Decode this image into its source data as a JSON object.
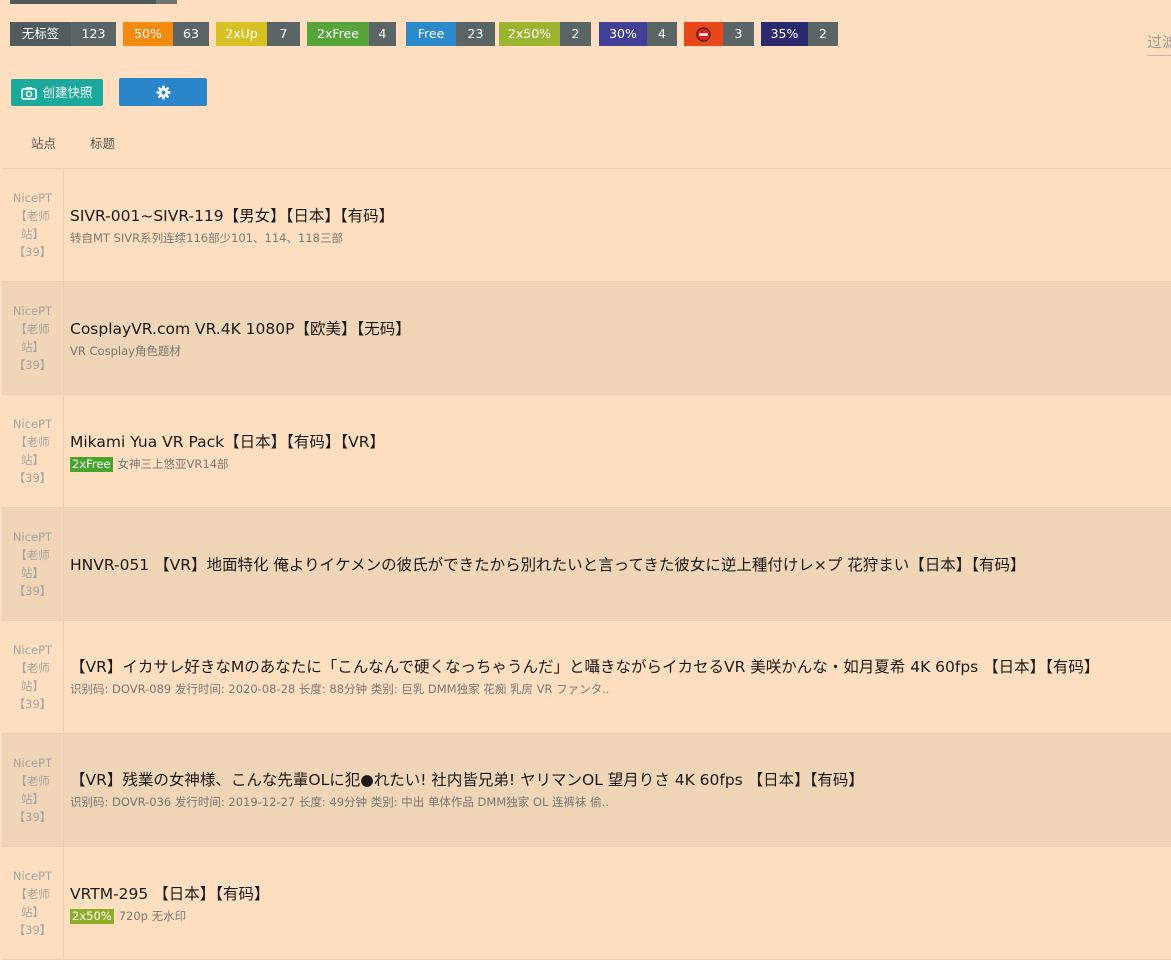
{
  "filters": [
    {
      "label": "无标签",
      "count": "123",
      "color": "#515c5c"
    },
    {
      "label": "50%",
      "count": "63",
      "color": "#f58a10"
    },
    {
      "label": "2xUp",
      "count": "7",
      "color": "#d8c125"
    },
    {
      "label": "2xFree",
      "count": "4",
      "color": "#55a53b"
    },
    {
      "label": "Free",
      "count": "23",
      "color": "#2a8acb"
    },
    {
      "label": "2x50%",
      "count": "2",
      "color": "#9bb531"
    },
    {
      "label": "30%",
      "count": "4",
      "color": "#414096"
    },
    {
      "label": "",
      "count": "3",
      "color": "#e9471a",
      "icon": "no-entry-icon"
    },
    {
      "label": "35%",
      "count": "2",
      "color": "#2c2a6e"
    }
  ],
  "filter_label": "过滤",
  "toolbar": {
    "snapshot_label": "创建快照",
    "settings_icon": "gear-icon"
  },
  "table": {
    "headers": [
      "站点",
      "标题"
    ]
  },
  "rows": [
    {
      "site": [
        "NicePT",
        "【老师",
        "站】",
        "【39】"
      ],
      "title": "SIVR-001~SIVR-119【男女】【日本】【有码】",
      "tag": "",
      "subtitle": "转自MT SIVR系列连续116部少101、114、118三部"
    },
    {
      "site": [
        "NicePT",
        "【老师",
        "站】",
        "【39】"
      ],
      "title": "CosplayVR.com VR.4K 1080P【欧美】【无码】",
      "tag": "",
      "subtitle": "VR Cosplay角色题材"
    },
    {
      "site": [
        "NicePT",
        "【老师",
        "站】",
        "【39】"
      ],
      "title": "Mikami Yua VR Pack【日本】【有码】【VR】",
      "tag": "2xFree",
      "subtitle": "女神三上悠亚VR14部"
    },
    {
      "site": [
        "NicePT",
        "【老师",
        "站】",
        "【39】"
      ],
      "title": "HNVR-051 【VR】地面特化 俺よりイケメンの彼氏ができたから別れたいと言ってきた彼女に逆上種付けレ×プ 花狩まい【日本】【有码】",
      "tag": "",
      "subtitle": ""
    },
    {
      "site": [
        "NicePT",
        "【老师",
        "站】",
        "【39】"
      ],
      "title": "【VR】イカサレ好きなMのあなたに「こんなんで硬くなっちゃうんだ」と囁きながらイカセるVR 美咲かんな・如月夏希 4K 60fps 【日本】【有码】",
      "tag": "",
      "subtitle": "识别码: DOVR-089 发行时间: 2020-08-28 长度: 88分钟 类别: 巨乳 DMM独家 花痴 乳房 VR ファンタ.."
    },
    {
      "site": [
        "NicePT",
        "【老师",
        "站】",
        "【39】"
      ],
      "title": "【VR】残業の女神様、こんな先輩OLに犯●れたい! 社内皆兄弟! ヤリマンOL 望月りさ 4K 60fps 【日本】【有码】",
      "tag": "",
      "subtitle": "识别码: DOVR-036 发行时间: 2019-12-27 长度: 49分钟 类别: 中出 单体作品 DMM独家 OL 连裤袜 偷.."
    },
    {
      "site": [
        "NicePT",
        "【老师",
        "站】",
        "【39】"
      ],
      "title": "VRTM-295 【日本】【有码】",
      "tag": "2x50%",
      "subtitle": "720p 无水印"
    }
  ]
}
